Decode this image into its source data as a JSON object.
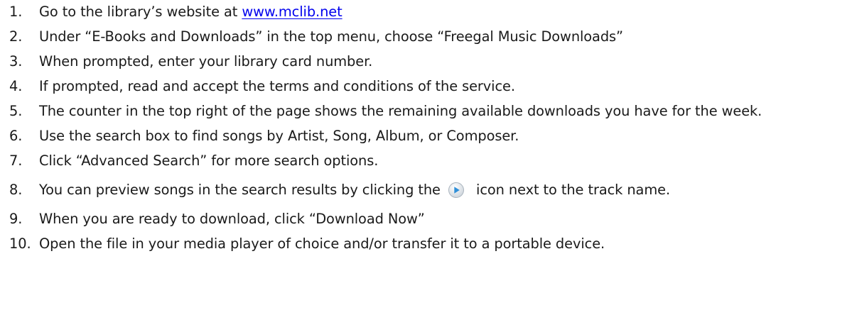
{
  "steps": [
    {
      "num": "1.",
      "text": "Go to the library’s website at ",
      "link": "www.mclib.net"
    },
    {
      "num": "2.",
      "text": "Under “E-Books and Downloads” in the top menu, choose “Freegal Music Downloads”"
    },
    {
      "num": "3.",
      "text": "When prompted, enter your library card number."
    },
    {
      "num": "4.",
      "text": "If prompted, read and accept the terms and conditions of the service."
    },
    {
      "num": "5.",
      "text": "The counter in the top right of the page shows the remaining available downloads you have for the week."
    },
    {
      "num": "6.",
      "text": "Use the search box to find songs by Artist, Song, Album, or Composer."
    },
    {
      "num": "7.",
      "text": "Click “Advanced Search” for more search options."
    },
    {
      "num": "8.",
      "text_before": "You can preview songs in the search results by clicking the",
      "text_after": "icon next to the track name.",
      "icon": "play-circle-icon"
    },
    {
      "num": "9.",
      "text": "When you are ready to download, click “Download Now”"
    },
    {
      "num": "10.",
      "text": "Open the file in your media player of choice and/or transfer it to a portable device."
    }
  ],
  "colors": {
    "text": "#1a1a1a",
    "link": "#0000ee",
    "icon_blue": "#2f8fd8"
  }
}
